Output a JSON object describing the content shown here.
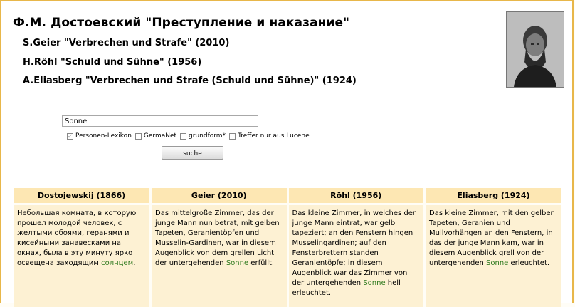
{
  "header": {
    "title": "Ф.М. Достоевский \"Преступление и наказание\"",
    "translations": [
      "S.Geier \"Verbrechen und Strafe\" (2010)",
      "H.Röhl \"Schuld und Sühne\" (1956)",
      "A.Eliasberg \"Verbrechen und Strafe (Schuld und Sühne)\" (1924)"
    ]
  },
  "search": {
    "value": "Sonne",
    "options": [
      {
        "label": "Personen-Lexikon",
        "checked": true
      },
      {
        "label": "GermaNet",
        "checked": false
      },
      {
        "label": "grundform*",
        "checked": false
      },
      {
        "label": "Treffer nur aus Lucene",
        "checked": false
      }
    ],
    "button_label": "suche"
  },
  "results": {
    "columns": [
      "Dostojewskij (1866)",
      "Geier (2010)",
      "Röhl (1956)",
      "Eliasberg (1924)"
    ],
    "cells": [
      {
        "before": "Небольшая комната, в которую прошел молодой человек, с желтыми обоями, геранями и кисейными занавесками на окнах, была в эту минуту ярко освещена заходящим ",
        "hit": "солнцем",
        "after": "."
      },
      {
        "before": "Das mittelgroße Zimmer, das der junge Mann nun betrat, mit gelben Tapeten, Geranientöpfen und Musselin-Gardinen, war in diesem Augenblick von dem grellen Licht der untergehenden ",
        "hit": "Sonne",
        "after": " erfüllt."
      },
      {
        "before": "Das kleine Zimmer, in welches der junge Mann eintrat, war gelb tapeziert; an den Fenstern hingen Musselingardinen; auf den Fensterbrettern standen Geranientöpfe; in diesem Augenblick war das Zimmer von der untergehenden ",
        "hit": "Sonne",
        "after": " hell erleuchtet."
      },
      {
        "before": "Das kleine Zimmer, mit den gelben Tapeten, Geranien und Mullvorhängen an den Fenstern, in das der junge Mann kam, war in diesem Augenblick grell von der untergehenden ",
        "hit": "Sonne",
        "after": " erleuchtet."
      }
    ]
  },
  "colors": {
    "accent_border": "#e8b74a",
    "header_bg": "#fde7b3",
    "cell_bg": "#fdf1d3",
    "highlight": "#2f7a1e"
  }
}
